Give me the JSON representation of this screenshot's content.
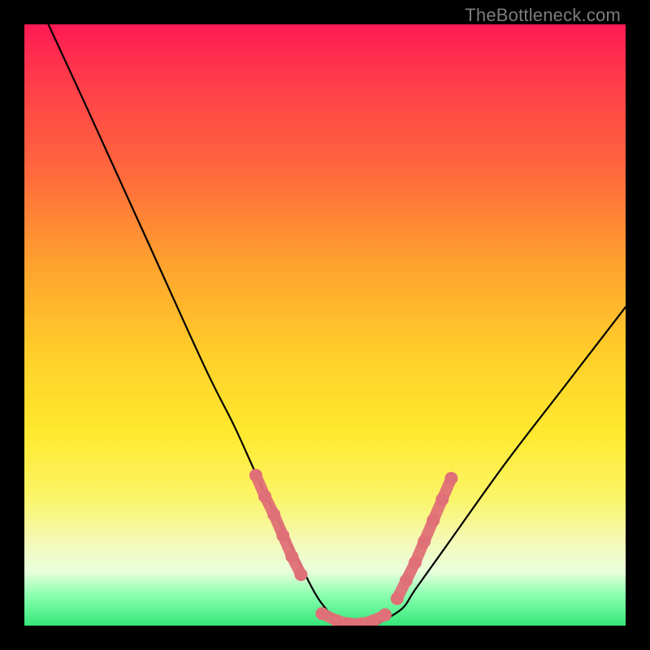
{
  "watermark": "TheBottleneck.com",
  "chart_data": {
    "type": "line",
    "title": "",
    "xlabel": "",
    "ylabel": "",
    "xlim": [
      0,
      100
    ],
    "ylim": [
      0,
      100
    ],
    "series": [
      {
        "name": "bottleneck-curve",
        "x": [
          4,
          10,
          20,
          30,
          35,
          40,
          45,
          48,
          50,
          52,
          55,
          58,
          60,
          63,
          65,
          70,
          80,
          90,
          100
        ],
        "values": [
          100,
          87,
          65,
          43,
          33,
          22,
          12,
          6,
          3,
          1,
          0,
          0,
          1,
          3,
          6,
          13,
          27,
          40,
          53
        ]
      }
    ],
    "marker_clusters": [
      {
        "name": "left-slope-dots",
        "color": "#e07077",
        "points": [
          {
            "x": 38.5,
            "y": 25.0
          },
          {
            "x": 40.0,
            "y": 21.5
          },
          {
            "x": 41.5,
            "y": 18.5
          },
          {
            "x": 43.0,
            "y": 15.0
          },
          {
            "x": 44.5,
            "y": 11.5
          },
          {
            "x": 46.0,
            "y": 8.5
          }
        ]
      },
      {
        "name": "valley-dots",
        "color": "#e07077",
        "points": [
          {
            "x": 49.5,
            "y": 2.0
          },
          {
            "x": 52.0,
            "y": 0.8
          },
          {
            "x": 54.0,
            "y": 0.3
          },
          {
            "x": 56.0,
            "y": 0.3
          },
          {
            "x": 58.0,
            "y": 0.8
          },
          {
            "x": 60.0,
            "y": 1.8
          }
        ]
      },
      {
        "name": "right-slope-dots",
        "color": "#e07077",
        "points": [
          {
            "x": 62.0,
            "y": 4.5
          },
          {
            "x": 63.5,
            "y": 7.5
          },
          {
            "x": 65.0,
            "y": 10.5
          },
          {
            "x": 66.5,
            "y": 14.0
          },
          {
            "x": 68.0,
            "y": 17.5
          },
          {
            "x": 69.5,
            "y": 21.0
          },
          {
            "x": 71.0,
            "y": 24.5
          }
        ]
      }
    ]
  }
}
